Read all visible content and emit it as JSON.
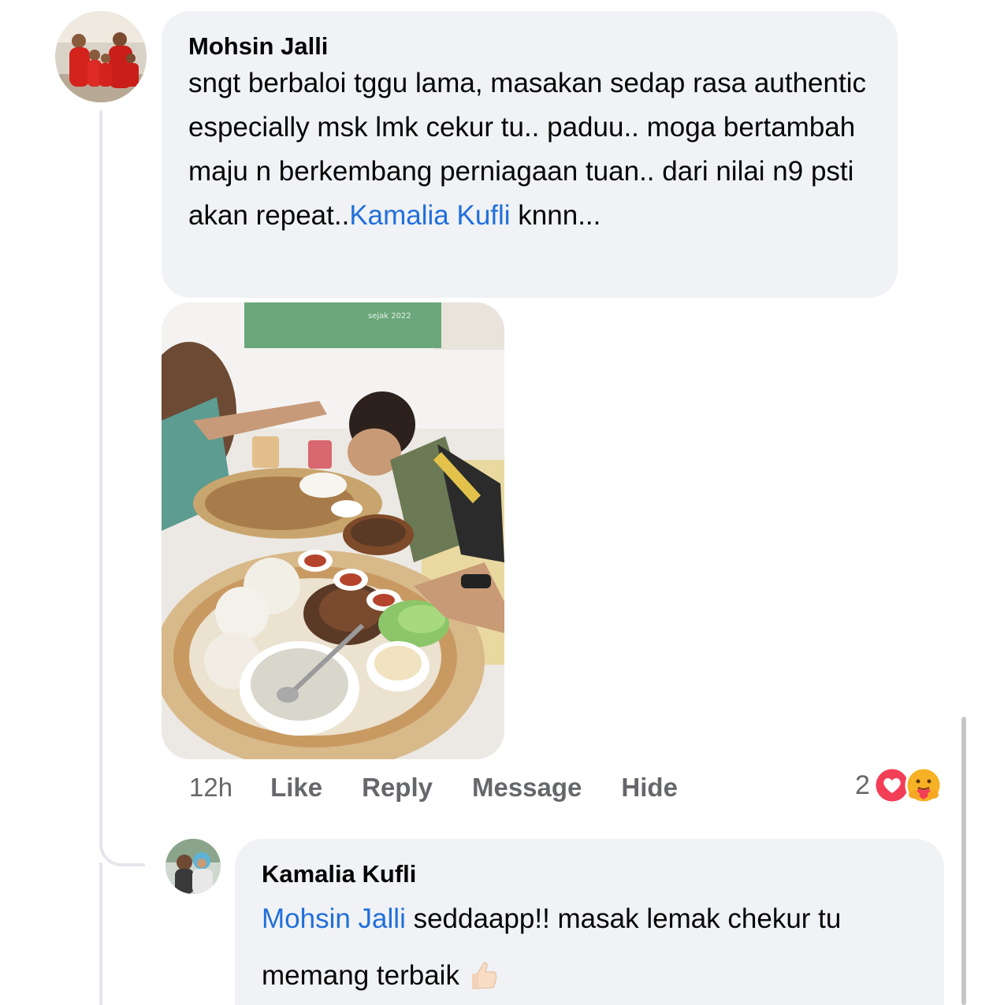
{
  "comment": {
    "author": "Mohsin Jalli",
    "text_before_mention": "sngt berbaloi tggu lama, masakan sedap rasa authentic especially msk lmk cekur tu.. paduu.. moga bertambah maju n berkembang perniagaan tuan.. dari nilai n9 psti akan repeat..",
    "mention": "Kamalia Kufli",
    "text_after_mention": " knnn...",
    "photo_banner_text": "sejak 2022",
    "time": "12h",
    "actions": {
      "like": "Like",
      "reply": "Reply",
      "message": "Message",
      "hide": "Hide"
    },
    "reaction_count": "2",
    "reaction_icons": [
      "love-reaction-icon",
      "care-reaction-icon"
    ]
  },
  "reply": {
    "author": "Kamalia Kufli",
    "mention": "Mohsin Jalli",
    "text": " seddaapp!! masak lemak chekur tu memang terbaik",
    "emoji": "thumbs-up-icon"
  },
  "colors": {
    "mention": "#216fdb",
    "bubble": "#f0f2f5",
    "secondary_text": "#65676b",
    "love": "#f33e58"
  }
}
